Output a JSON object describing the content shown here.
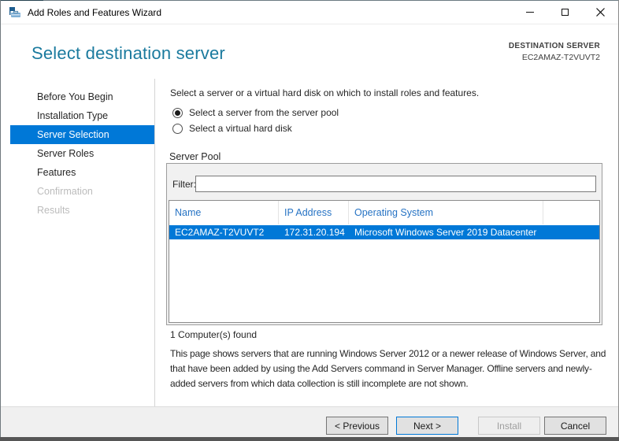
{
  "window": {
    "title": "Add Roles and Features Wizard",
    "controls": {
      "minimize": "minimize",
      "maximize": "maximize",
      "close": "close"
    }
  },
  "header": {
    "title": "Select destination server",
    "destination_label": "DESTINATION SERVER",
    "destination_server": "EC2AMAZ-T2VUVT2"
  },
  "sidebar": {
    "items": [
      {
        "label": "Before You Begin",
        "state": "enabled"
      },
      {
        "label": "Installation Type",
        "state": "enabled"
      },
      {
        "label": "Server Selection",
        "state": "active"
      },
      {
        "label": "Server Roles",
        "state": "enabled"
      },
      {
        "label": "Features",
        "state": "enabled"
      },
      {
        "label": "Confirmation",
        "state": "disabled"
      },
      {
        "label": "Results",
        "state": "disabled"
      }
    ]
  },
  "main": {
    "intro": "Select a server or a virtual hard disk on which to install roles and features.",
    "radios": [
      {
        "label": "Select a server from the server pool",
        "selected": true
      },
      {
        "label": "Select a virtual hard disk",
        "selected": false
      }
    ],
    "server_pool": {
      "title": "Server Pool",
      "filter_label": "Filter:",
      "filter_value": "",
      "table": {
        "columns": [
          "Name",
          "IP Address",
          "Operating System"
        ],
        "rows": [
          [
            "EC2AMAZ-T2VUVT2",
            "172.31.20.194",
            "Microsoft Windows Server 2019 Datacenter"
          ]
        ],
        "selected_row": 0
      },
      "found_text": "1 Computer(s) found"
    },
    "description": "This page shows servers that are running Windows Server 2012 or a newer release of Windows Server, and that have been added by using the Add Servers command in Server Manager. Offline servers and newly-added servers from which data collection is still incomplete are not shown."
  },
  "footer": {
    "previous_label": "< Previous",
    "next_label": "Next >",
    "install_label": "Install",
    "cancel_label": "Cancel"
  },
  "colors": {
    "accent": "#0078d7",
    "heading": "#1a7a9e",
    "table_header_text": "#2673c4",
    "selection": "#0078d7",
    "footer_bg": "#f0f0f0"
  }
}
